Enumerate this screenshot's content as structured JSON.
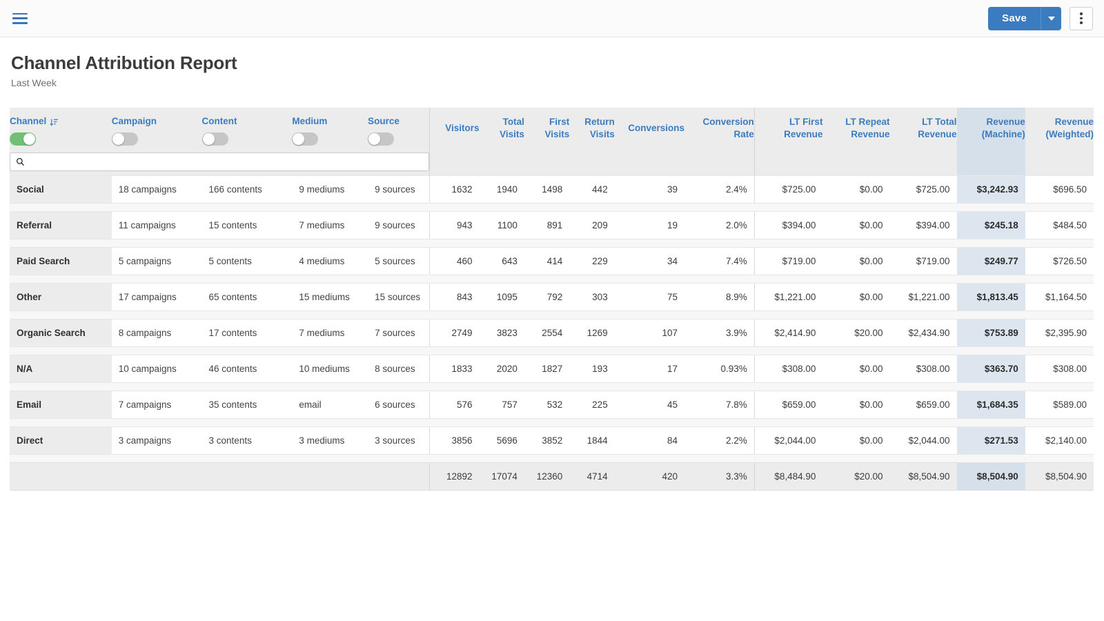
{
  "topbar": {
    "menu_icon": "hamburger-icon",
    "save_label": "Save",
    "caret_icon": "chevron-down-icon",
    "kebab_icon": "more-vertical-icon"
  },
  "header": {
    "title": "Channel Attribution Report",
    "subtitle": "Last Week"
  },
  "search": {
    "value": "",
    "placeholder": "",
    "icon": "search-icon"
  },
  "colors": {
    "accent": "#3a7cbf",
    "toggle_on": "#72c078",
    "toggle_off": "#c6c6c6",
    "highlight_column": "#dde6ef",
    "header_bg": "#ececec"
  },
  "table": {
    "dimension_columns": [
      {
        "label": "Channel",
        "toggle": "on",
        "sort_icon": "sort-descending-icon"
      },
      {
        "label": "Campaign",
        "toggle": "off",
        "sort_icon": ""
      },
      {
        "label": "Content",
        "toggle": "off",
        "sort_icon": ""
      },
      {
        "label": "Medium",
        "toggle": "off",
        "sort_icon": ""
      },
      {
        "label": "Source",
        "toggle": "off",
        "sort_icon": ""
      }
    ],
    "metric_columns": [
      {
        "label": "Visitors",
        "highlight": false
      },
      {
        "label": "Total Visits",
        "highlight": false
      },
      {
        "label": "First Visits",
        "highlight": false
      },
      {
        "label": "Return Visits",
        "highlight": false
      },
      {
        "label": "Conversions",
        "highlight": false
      },
      {
        "label": "Conversion Rate",
        "highlight": false
      },
      {
        "label": "LT First Revenue",
        "highlight": false
      },
      {
        "label": "LT Repeat Revenue",
        "highlight": false
      },
      {
        "label": "LT Total Revenue",
        "highlight": false
      },
      {
        "label": "Revenue (Machine)",
        "highlight": true
      },
      {
        "label": "Revenue (Weighted)",
        "highlight": false
      }
    ],
    "rows": [
      {
        "channel": "Social",
        "campaign": "18 campaigns",
        "content": "166 contents",
        "medium": "9 mediums",
        "source": "9 sources",
        "visitors": "1632",
        "total_visits": "1940",
        "first_visits": "1498",
        "return_visits": "442",
        "conversions": "39",
        "conversion_rate": "2.4%",
        "lt_first_revenue": "$725.00",
        "lt_repeat_revenue": "$0.00",
        "lt_total_revenue": "$725.00",
        "revenue_machine": "$3,242.93",
        "revenue_weighted": "$696.50"
      },
      {
        "channel": "Referral",
        "campaign": "11 campaigns",
        "content": "15 contents",
        "medium": "7 mediums",
        "source": "9 sources",
        "visitors": "943",
        "total_visits": "1100",
        "first_visits": "891",
        "return_visits": "209",
        "conversions": "19",
        "conversion_rate": "2.0%",
        "lt_first_revenue": "$394.00",
        "lt_repeat_revenue": "$0.00",
        "lt_total_revenue": "$394.00",
        "revenue_machine": "$245.18",
        "revenue_weighted": "$484.50"
      },
      {
        "channel": "Paid Search",
        "campaign": "5 campaigns",
        "content": "5 contents",
        "medium": "4 mediums",
        "source": "5 sources",
        "visitors": "460",
        "total_visits": "643",
        "first_visits": "414",
        "return_visits": "229",
        "conversions": "34",
        "conversion_rate": "7.4%",
        "lt_first_revenue": "$719.00",
        "lt_repeat_revenue": "$0.00",
        "lt_total_revenue": "$719.00",
        "revenue_machine": "$249.77",
        "revenue_weighted": "$726.50"
      },
      {
        "channel": "Other",
        "campaign": "17 campaigns",
        "content": "65 contents",
        "medium": "15 mediums",
        "source": "15 sources",
        "visitors": "843",
        "total_visits": "1095",
        "first_visits": "792",
        "return_visits": "303",
        "conversions": "75",
        "conversion_rate": "8.9%",
        "lt_first_revenue": "$1,221.00",
        "lt_repeat_revenue": "$0.00",
        "lt_total_revenue": "$1,221.00",
        "revenue_machine": "$1,813.45",
        "revenue_weighted": "$1,164.50"
      },
      {
        "channel": "Organic Search",
        "campaign": "8 campaigns",
        "content": "17 contents",
        "medium": "7 mediums",
        "source": "7 sources",
        "visitors": "2749",
        "total_visits": "3823",
        "first_visits": "2554",
        "return_visits": "1269",
        "conversions": "107",
        "conversion_rate": "3.9%",
        "lt_first_revenue": "$2,414.90",
        "lt_repeat_revenue": "$20.00",
        "lt_total_revenue": "$2,434.90",
        "revenue_machine": "$753.89",
        "revenue_weighted": "$2,395.90"
      },
      {
        "channel": "N/A",
        "campaign": "10 campaigns",
        "content": "46 contents",
        "medium": "10 mediums",
        "source": "8 sources",
        "visitors": "1833",
        "total_visits": "2020",
        "first_visits": "1827",
        "return_visits": "193",
        "conversions": "17",
        "conversion_rate": "0.93%",
        "lt_first_revenue": "$308.00",
        "lt_repeat_revenue": "$0.00",
        "lt_total_revenue": "$308.00",
        "revenue_machine": "$363.70",
        "revenue_weighted": "$308.00"
      },
      {
        "channel": "Email",
        "campaign": "7 campaigns",
        "content": "35 contents",
        "medium": "email",
        "source": "6 sources",
        "visitors": "576",
        "total_visits": "757",
        "first_visits": "532",
        "return_visits": "225",
        "conversions": "45",
        "conversion_rate": "7.8%",
        "lt_first_revenue": "$659.00",
        "lt_repeat_revenue": "$0.00",
        "lt_total_revenue": "$659.00",
        "revenue_machine": "$1,684.35",
        "revenue_weighted": "$589.00"
      },
      {
        "channel": "Direct",
        "campaign": "3 campaigns",
        "content": "3 contents",
        "medium": "3 mediums",
        "source": "3 sources",
        "visitors": "3856",
        "total_visits": "5696",
        "first_visits": "3852",
        "return_visits": "1844",
        "conversions": "84",
        "conversion_rate": "2.2%",
        "lt_first_revenue": "$2,044.00",
        "lt_repeat_revenue": "$0.00",
        "lt_total_revenue": "$2,044.00",
        "revenue_machine": "$271.53",
        "revenue_weighted": "$2,140.00"
      }
    ],
    "totals": {
      "channel": "",
      "campaign": "",
      "content": "",
      "medium": "",
      "source": "",
      "visitors": "12892",
      "total_visits": "17074",
      "first_visits": "12360",
      "return_visits": "4714",
      "conversions": "420",
      "conversion_rate": "3.3%",
      "lt_first_revenue": "$8,484.90",
      "lt_repeat_revenue": "$20.00",
      "lt_total_revenue": "$8,504.90",
      "revenue_machine": "$8,504.90",
      "revenue_weighted": "$8,504.90"
    }
  }
}
